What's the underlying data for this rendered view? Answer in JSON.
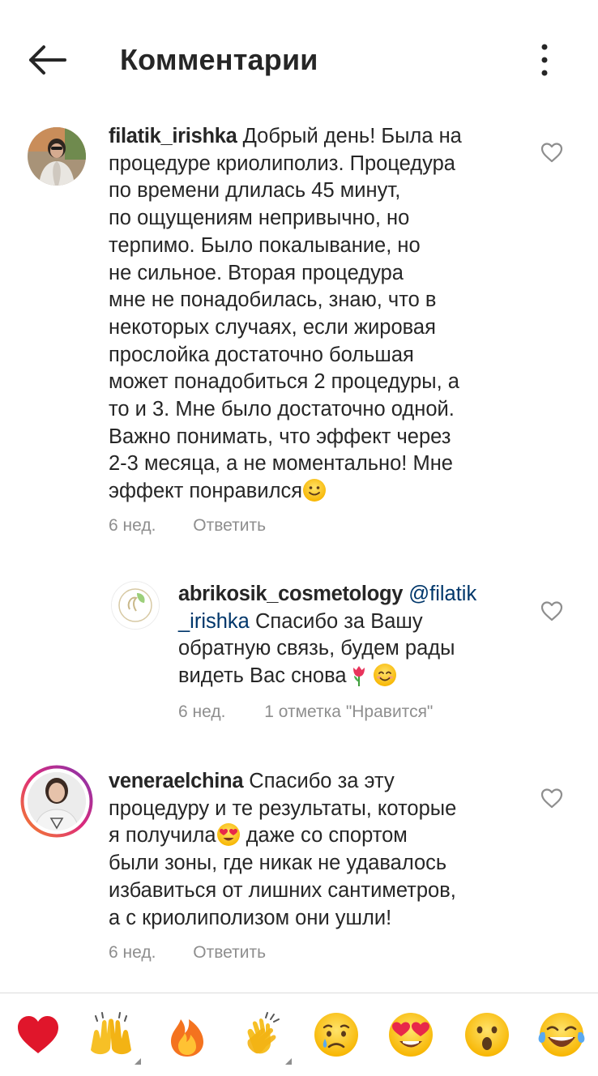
{
  "header": {
    "title": "Комментарии",
    "back_icon": "arrow-left-icon",
    "more_icon": "vertical-dots-icon"
  },
  "comments": [
    {
      "username": "filatik_irishka",
      "lines": [
        "Добрый день! Была на",
        "процедуре криолиполиз. Процедура",
        "по времени длилась 45 минут,",
        "по ощущениям непривычно, но",
        "терпимо. Было покалывание, но",
        "не сильное. Вторая процедура",
        "мне не понадобилась, знаю, что в",
        "некоторых случаях, если жировая",
        "прослойка достаточно большая",
        "может понадобиться 2 процедуры, а",
        "то и 3. Мне было достаточно одной.",
        "Важно понимать, что эффект через",
        "2-3 месяца, а не моментально! Мне",
        "эффект понравился"
      ],
      "emoji": "slightly-smiling-face",
      "time": "6 нед.",
      "action": "Ответить"
    },
    {
      "username": "abrikosik_cosmetology",
      "mention_part1": "@filatik",
      "mention_part2": "_irishka",
      "lines": [
        "Спасибо за Вашу",
        "обратную связь, будем рады",
        "видеть Вас снова"
      ],
      "emojis": [
        "tulip",
        "smiling-face-with-smiling-eyes"
      ],
      "time": "6 нед.",
      "likes": "1 отметка \"Нравится\""
    },
    {
      "username": "veneraelchina",
      "lines": [
        "Спасибо за эту",
        "процедуру и те результаты, которые",
        "я получила",
        "даже со спортом",
        "были зоны, где никак не удавалось",
        "избавиться от лишних сантиметров,",
        "а с криолиполизом они ушли!"
      ],
      "emoji": "heart-eyes",
      "time": "6 нед.",
      "action": "Ответить"
    }
  ],
  "emoji_bar": [
    {
      "name": "red-heart"
    },
    {
      "name": "raising-hands"
    },
    {
      "name": "fire"
    },
    {
      "name": "clapping-hands"
    },
    {
      "name": "crying-face"
    },
    {
      "name": "heart-eyes"
    },
    {
      "name": "surprised-face"
    },
    {
      "name": "tears-of-joy"
    }
  ],
  "colors": {
    "text": "#262626",
    "meta": "#8e8e8e",
    "mention": "#00376b",
    "divider": "#dbdbdb",
    "story_ring": [
      "#f58529",
      "#dd2a7b",
      "#8134af"
    ]
  }
}
